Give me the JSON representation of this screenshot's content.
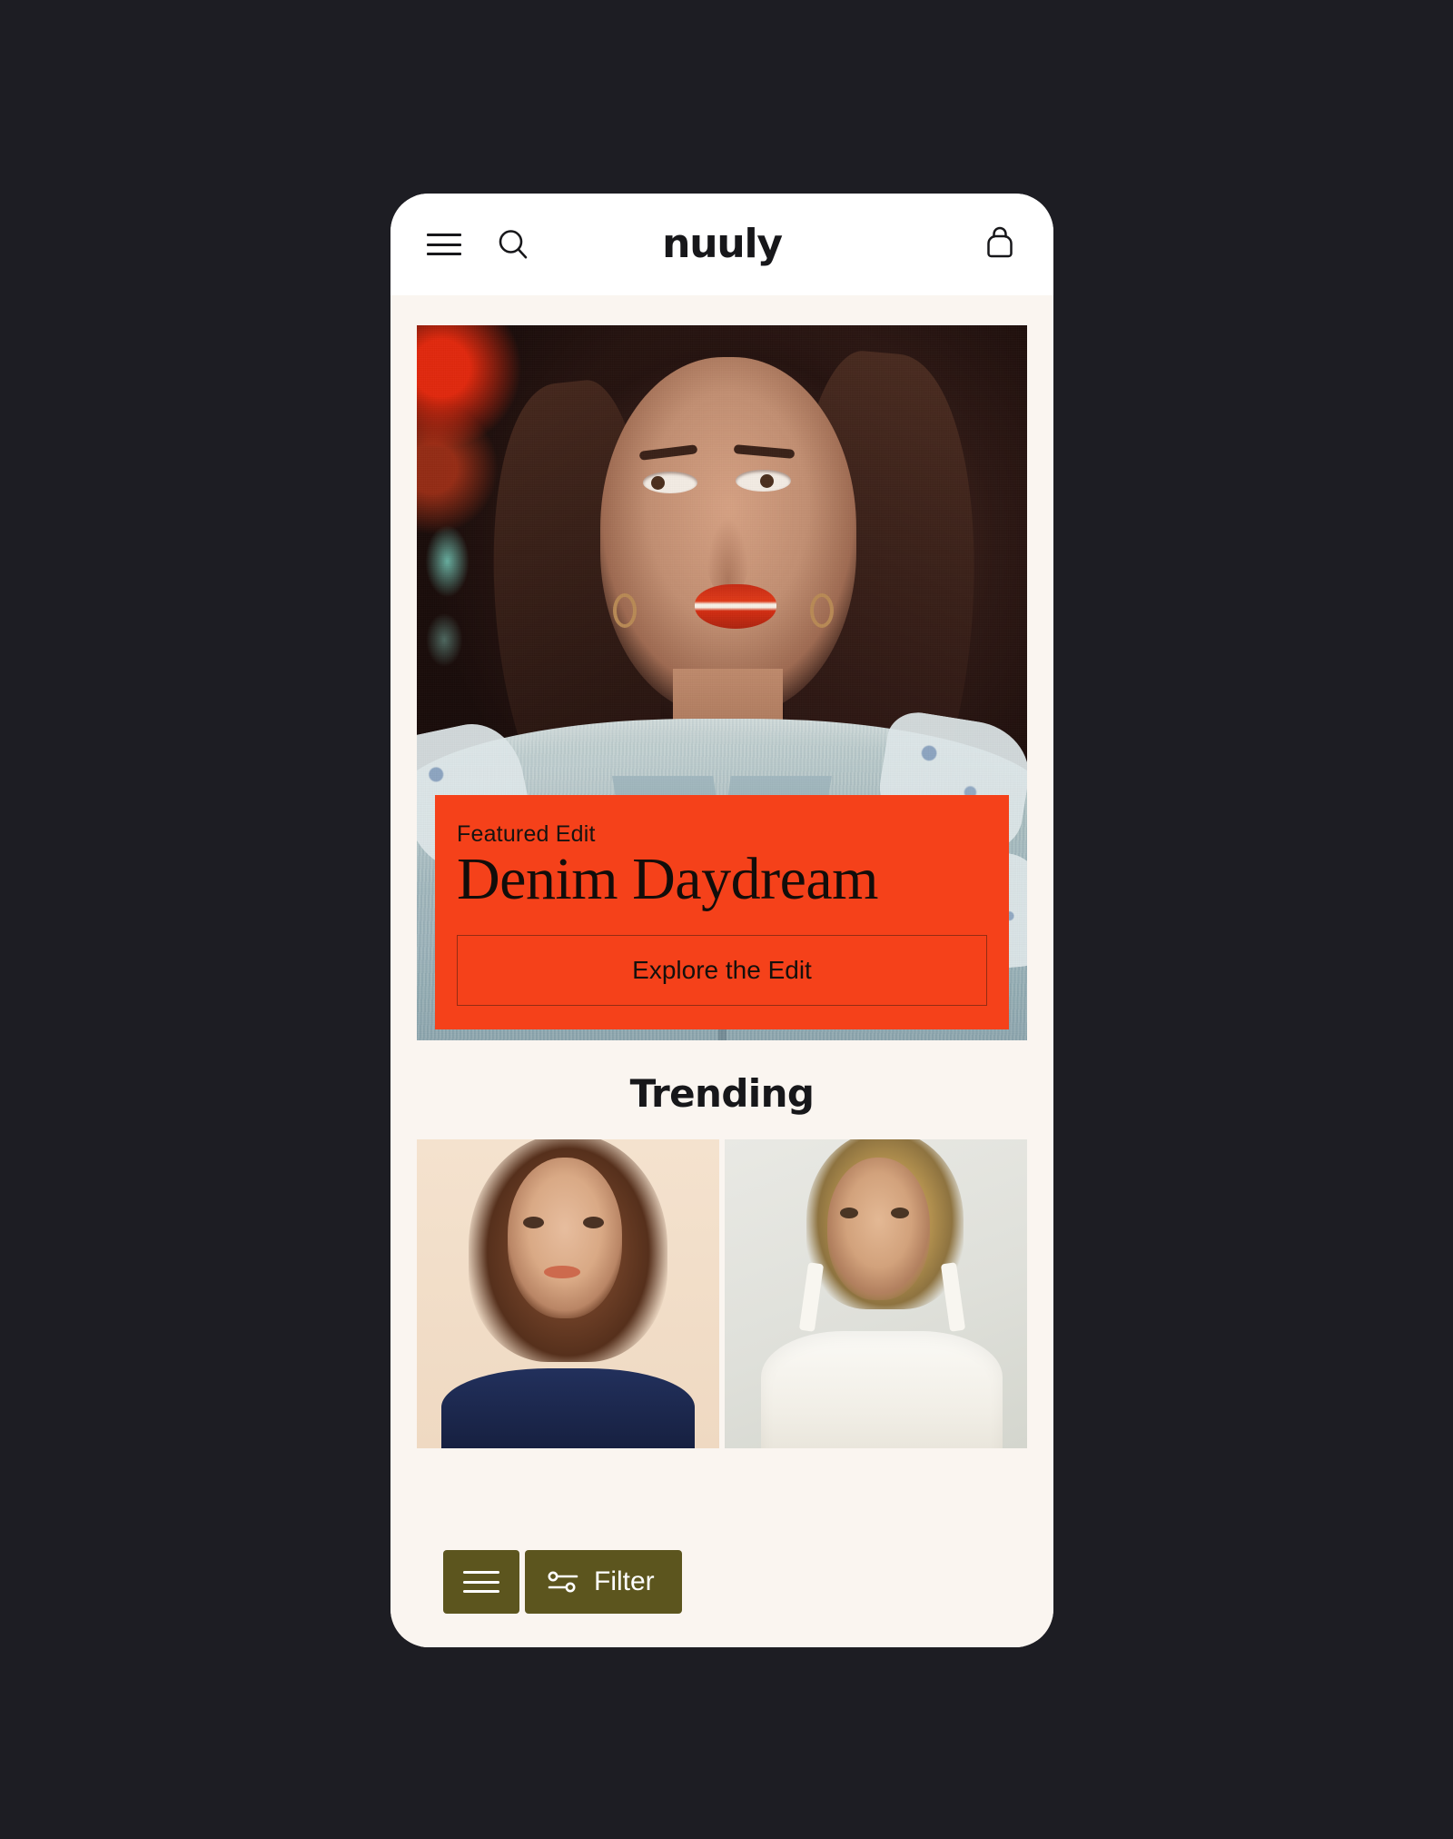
{
  "app": {
    "brand": "nuuly",
    "background_color": "#1d1d23",
    "surface_color": "#faf5f0",
    "accent_orange": "#f5411a",
    "accent_olive": "#5c551e"
  },
  "header": {
    "menu_icon": "hamburger-menu-icon",
    "search_icon": "search-icon",
    "logo_text": "nuuly",
    "bag_icon": "shopping-bag-icon"
  },
  "hero": {
    "image_alt": "Woman with dark hair and red lipstick wearing a light acid-wash denim jacket at night",
    "promo": {
      "eyebrow": "Featured Edit",
      "title": "Denim Daydream",
      "cta_label": "Explore the Edit"
    }
  },
  "trending": {
    "heading": "Trending",
    "cards": [
      {
        "image_alt": "Model with brown hair in navy blue top on cream backdrop"
      },
      {
        "image_alt": "Blonde model in white sleeveless top against light grey wall"
      }
    ]
  },
  "filter_bar": {
    "view_toggle_icon": "list-view-icon",
    "filter_icon": "sliders-filter-icon",
    "filter_label": "Filter"
  }
}
